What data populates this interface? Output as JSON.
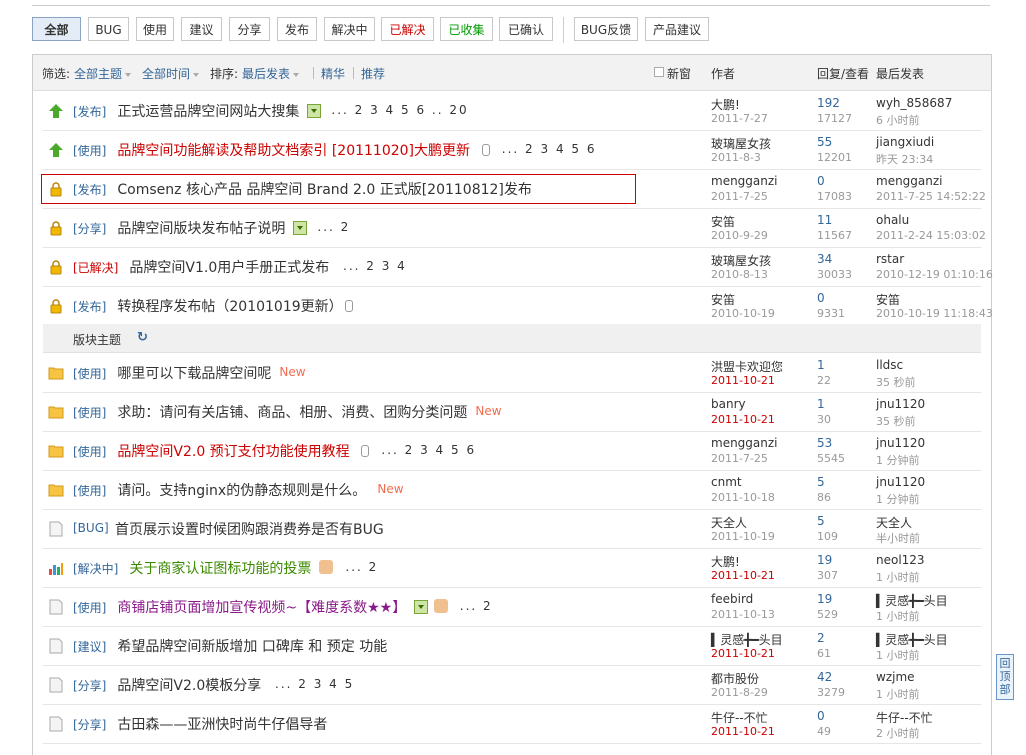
{
  "filters": [
    {
      "label": "全部",
      "style": "active"
    },
    {
      "label": "BUG",
      "style": ""
    },
    {
      "label": "使用",
      "style": ""
    },
    {
      "label": "建议",
      "style": ""
    },
    {
      "label": "分享",
      "style": ""
    },
    {
      "label": "发布",
      "style": ""
    },
    {
      "label": "解决中",
      "style": ""
    },
    {
      "label": "已解决",
      "style": "red"
    },
    {
      "label": "已收集",
      "style": "green"
    },
    {
      "label": "已确认",
      "style": ""
    },
    {
      "label": "BUG反馈",
      "style": ""
    },
    {
      "label": "产品建议",
      "style": ""
    }
  ],
  "header": {
    "filter_prefix": "筛选:",
    "all_topics": "全部主题",
    "all_time": "全部时间",
    "sort_prefix": "排序:",
    "last_post": "最后发表",
    "digest": "精华",
    "recommend": "推荐",
    "new_window": "新窗",
    "col_author": "作者",
    "col_replies": "回复/查看",
    "col_last": "最后发表"
  },
  "section_label": "版块主题",
  "sticky_threads": [
    {
      "icon": "pin-up-icon",
      "cat": "[发布]",
      "title": "正式运营品牌空间网站大搜集",
      "style": "",
      "img": true,
      "clip": false,
      "pages": "... 2 3 4 5 6 .. 20",
      "author": "大鹏!",
      "adate": "2011-7-27",
      "replies": "192",
      "views": "17127",
      "last": "wyh_858687",
      "ltime": "6 小时前"
    },
    {
      "icon": "pin-up-icon",
      "cat": "[使用]",
      "title": "品牌空间功能解读及帮助文档索引 [20111020]大鹏更新",
      "style": "red",
      "img": false,
      "clip": true,
      "pages": "... 2 3 4 5 6",
      "author": "玻璃屋女孩",
      "adate": "2011-8-3",
      "replies": "55",
      "views": "12201",
      "last": "jiangxiudi",
      "ltime": "昨天 23:34"
    },
    {
      "icon": "lock-icon",
      "cat": "[发布]",
      "title": "Comsenz 核心产品 品牌空间 Brand 2.0 正式版[20110812]发布",
      "style": "",
      "img": false,
      "clip": false,
      "pages": "",
      "author": "mengganzi",
      "adate": "2011-7-25",
      "replies": "0",
      "views": "17083",
      "last": "mengganzi",
      "ltime": "2011-7-25 14:52:22"
    },
    {
      "icon": "lock-icon",
      "cat": "[分享]",
      "title": "品牌空间版块发布帖子说明",
      "style": "",
      "img": true,
      "clip": false,
      "pages": "... 2",
      "author": "安笛",
      "adate": "2010-9-29",
      "replies": "11",
      "views": "11567",
      "last": "ohalu",
      "ltime": "2011-2-24 15:03:02"
    },
    {
      "icon": "lock-icon",
      "cat": "[已解决]",
      "title": "品牌空间V1.0用户手册正式发布",
      "style": "",
      "img": false,
      "clip": false,
      "pages": "... 2 3 4",
      "author": "玻璃屋女孩",
      "adate": "2010-8-13",
      "replies": "34",
      "views": "30033",
      "last": "rstar",
      "ltime": "2010-12-19 01:10:16",
      "catred": true
    },
    {
      "icon": "lock-icon",
      "cat": "[发布]",
      "title": "转换程序发布帖（20101019更新）",
      "style": "",
      "img": false,
      "clip": true,
      "pages": "",
      "author": "安笛",
      "adate": "2010-10-19",
      "replies": "0",
      "views": "9331",
      "last": "安笛",
      "ltime": "2010-10-19 11:18:43"
    }
  ],
  "threads": [
    {
      "icon": "folder-icon",
      "cat": "[使用]",
      "title": "哪里可以下载品牌空间呢",
      "style": "",
      "new": "New",
      "pages": "",
      "author": "洪盟卡欢迎您",
      "adate": "2011-10-21",
      "hot": true,
      "replies": "1",
      "views": "22",
      "last": "lldsc",
      "ltime": "35 秒前"
    },
    {
      "icon": "folder-icon",
      "cat": "[使用]",
      "title": "求助：请问有关店铺、商品、相册、消费、团购分类问题",
      "style": "",
      "new": "New",
      "pages": "",
      "author": "banry",
      "adate": "2011-10-21",
      "hot": true,
      "replies": "1",
      "views": "30",
      "last": "jnu1120",
      "ltime": "35 秒前"
    },
    {
      "icon": "folder-icon",
      "cat": "[使用]",
      "title": "品牌空间V2.0 预订支付功能使用教程",
      "style": "red",
      "clip": true,
      "pages": "... 2 3 4 5 6",
      "author": "mengganzi",
      "adate": "2011-7-25",
      "replies": "53",
      "views": "5545",
      "last": "jnu1120",
      "ltime": "1 分钟前"
    },
    {
      "icon": "folder-icon",
      "cat": "[使用]",
      "title": "请问。支持nginx的伪静态规则是什么。",
      "style": "",
      "new": "New",
      "pages": "",
      "author": "cnmt",
      "adate": "2011-10-18",
      "replies": "5",
      "views": "86",
      "last": "jnu1120",
      "ltime": "1 分钟前"
    },
    {
      "icon": "doc-icon",
      "cat": "[BUG]",
      "title": "首页展示设置时候团购跟消费券是否有BUG",
      "style": "",
      "pages": "",
      "author": "天全人",
      "adate": "2011-10-19",
      "replies": "5",
      "views": "109",
      "last": "天全人",
      "ltime": "半小时前"
    },
    {
      "icon": "poll-icon",
      "cat": "[解决中]",
      "title": "关于商家认证图标功能的投票",
      "style": "green",
      "thumb": true,
      "pages": "... 2",
      "author": "大鹏!",
      "adate": "2011-10-21",
      "hot": true,
      "replies": "19",
      "views": "307",
      "last": "neol123",
      "ltime": "1 小时前"
    },
    {
      "icon": "doc-icon",
      "cat": "[使用]",
      "title": "商铺店铺页面增加宣传视频~【难度系数★★】",
      "style": "purple",
      "img": true,
      "thumb": true,
      "pages": "... 2",
      "author": "feebird",
      "adate": "2011-10-13",
      "replies": "19",
      "views": "529",
      "last": "▍灵感╋━头目",
      "ltime": "1 小时前"
    },
    {
      "icon": "doc-icon",
      "cat": "[建议]",
      "title": "希望品牌空间新版增加 口碑库 和 预定 功能",
      "style": "",
      "pages": "",
      "author": "▍灵感╋━头目",
      "adate": "2011-10-21",
      "hot": true,
      "replies": "2",
      "views": "61",
      "last": "▍灵感╋━头目",
      "ltime": "1 小时前"
    },
    {
      "icon": "doc-icon",
      "cat": "[分享]",
      "title": "品牌空间V2.0模板分享",
      "style": "",
      "pages": "... 2 3 4 5",
      "author": "都市股份",
      "adate": "2011-8-29",
      "replies": "42",
      "views": "3279",
      "last": "wzjme",
      "ltime": "1 小时前"
    },
    {
      "icon": "doc-icon",
      "cat": "[分享]",
      "title": "古田森——亚洲快时尚牛仔倡导者",
      "style": "",
      "pages": "",
      "author": "牛仔--不忙",
      "adate": "2011-10-21",
      "hot": true,
      "replies": "0",
      "views": "49",
      "last": "牛仔--不忙",
      "ltime": "2 小时前"
    }
  ],
  "back_to_top": "回顶部"
}
